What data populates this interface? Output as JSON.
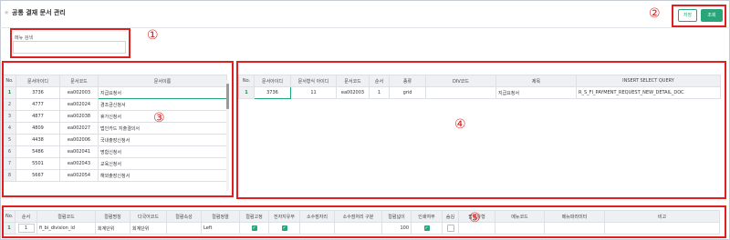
{
  "header": {
    "title": "공통 결재 문서 관리",
    "save_label": "저장",
    "search_label": "조회"
  },
  "filter": {
    "label": "메뉴 검색",
    "value": ""
  },
  "annotations": [
    "①",
    "②",
    "③",
    "④",
    "⑤"
  ],
  "left_grid": {
    "columns": [
      "No.",
      "문서아이디",
      "문서코드",
      "문서이름"
    ],
    "rows": [
      [
        "1",
        "3736",
        "ea002003",
        "지급요청서"
      ],
      [
        "2",
        "4777",
        "ea002024",
        "경조금신청서"
      ],
      [
        "3",
        "4877",
        "ea002038",
        "휴가신청서"
      ],
      [
        "4",
        "4809",
        "ea002027",
        "법인카드 지출결의서"
      ],
      [
        "5",
        "4438",
        "ea002006",
        "국내출장신청서"
      ],
      [
        "6",
        "5486",
        "ea002041",
        "명함신청서"
      ],
      [
        "7",
        "5501",
        "ea002043",
        "교육신청서"
      ],
      [
        "8",
        "5667",
        "ea002054",
        "해외출장신청서"
      ]
    ]
  },
  "right_grid": {
    "columns": [
      "No.",
      "문서아이디",
      "문서형식 아이디",
      "문서코드",
      "순서",
      "종류",
      "DIV코드",
      "제목",
      "INSERT SELECT QUERY"
    ],
    "rows": [
      [
        "1",
        "3736",
        "11",
        "ea002003",
        "1",
        "grid",
        "",
        "지급요청서",
        "R_S_FI_PAYMENT_REQUEST_NEW_DETAIL_DOC"
      ]
    ]
  },
  "bottom_grid": {
    "columns": [
      "No.",
      "순서",
      "컬럼코드",
      "컬럼명칭",
      "다국어코드",
      "컬럼속성",
      "컬럼정렬",
      "컬럼고정",
      "전자지유무",
      "소수점자리",
      "소수점처리 구분",
      "컬럼넓이",
      "인쇄여부",
      "숨김",
      "팝업유형",
      "메뉴코드",
      "메뉴파라미터",
      "비고"
    ],
    "rows": [
      {
        "no": "1",
        "order": "1",
        "code": "fi_bi_division_id",
        "name": "회계단위",
        "lang": "회계단위",
        "attr": "",
        "align": "Left",
        "fixed": true,
        "flag": true,
        "dec": "",
        "dec_type": "",
        "width": "100",
        "print": true,
        "hidden": false,
        "popup": "",
        "menu_code": "",
        "menu_param": "",
        "note": ""
      }
    ]
  }
}
